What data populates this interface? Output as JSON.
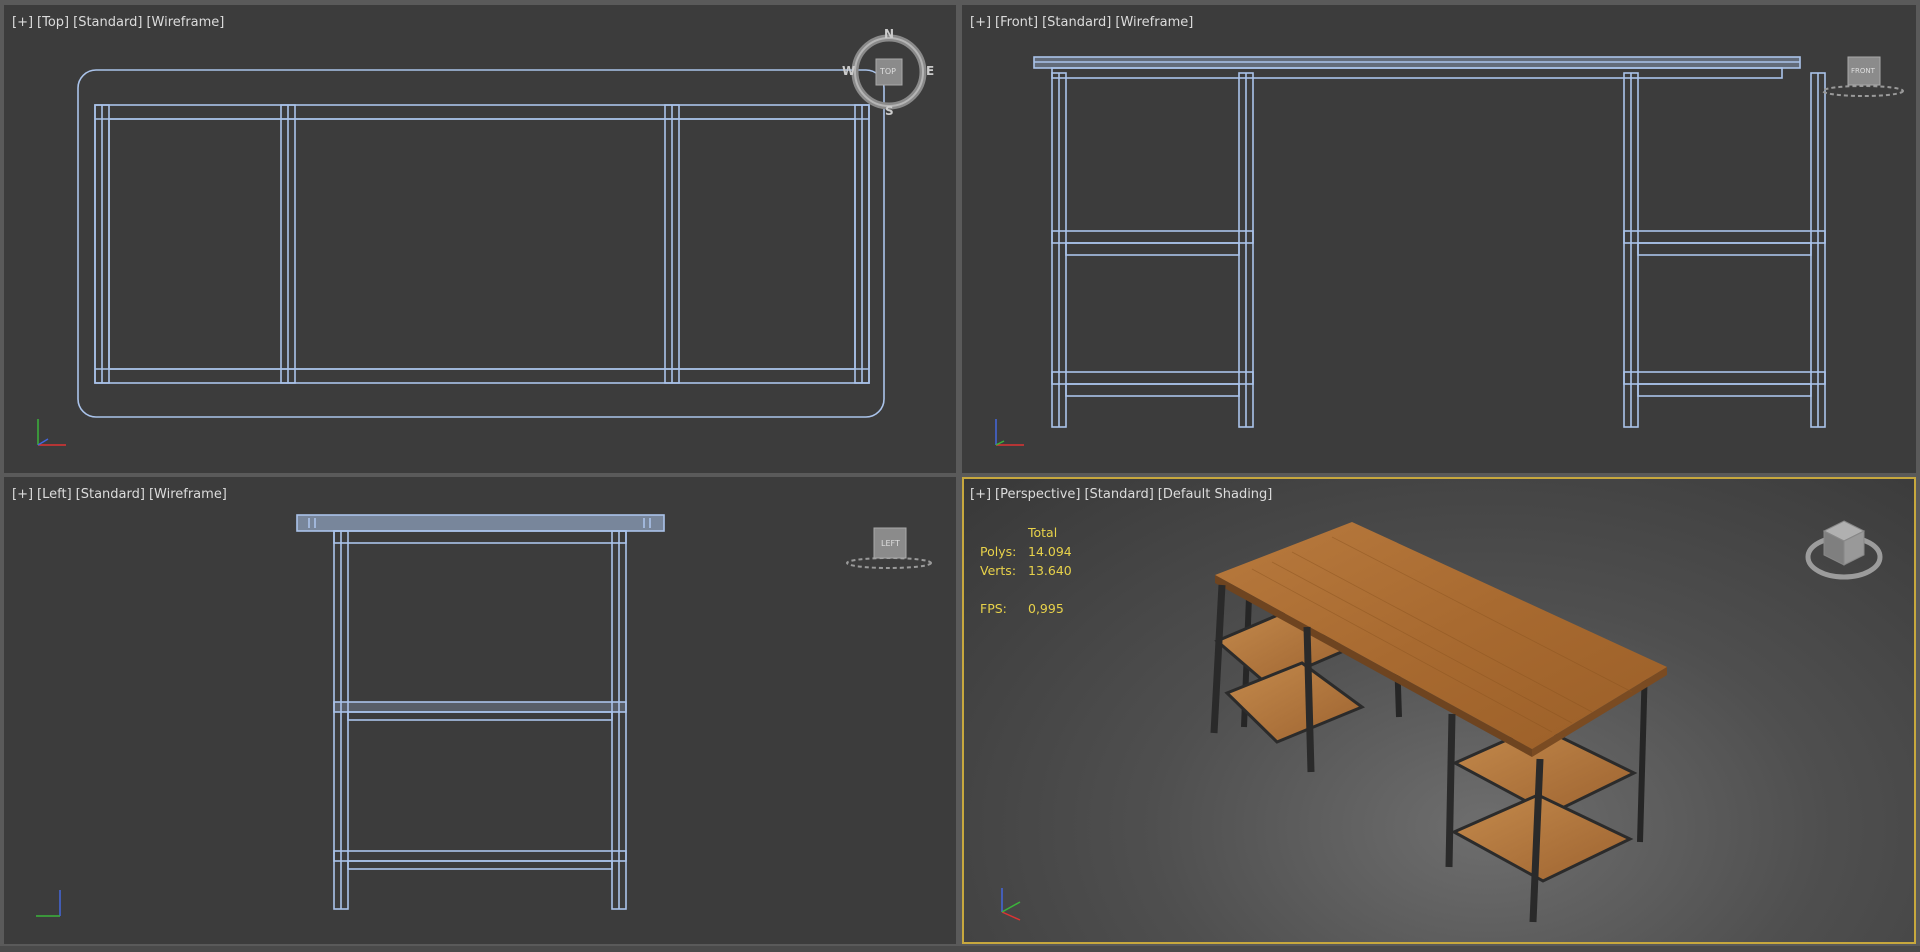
{
  "viewports": {
    "top": {
      "plus": "[+]",
      "view": "[Top]",
      "style": "[Standard]",
      "shading": "[Wireframe]",
      "cube_label": "TOP",
      "compass": {
        "n": "N",
        "s": "S",
        "e": "E",
        "w": "W"
      }
    },
    "front": {
      "plus": "[+]",
      "view": "[Front]",
      "style": "[Standard]",
      "shading": "[Wireframe]",
      "cube_label": "FRONT"
    },
    "left": {
      "plus": "[+]",
      "view": "[Left]",
      "style": "[Standard]",
      "shading": "[Wireframe]",
      "cube_label": "LEFT"
    },
    "persp": {
      "plus": "[+]",
      "view": "[Perspective]",
      "style": "[Standard]",
      "shading": "[Default Shading]"
    }
  },
  "stats": {
    "header": "Total",
    "polys_label": "Polys:",
    "polys": "14.094",
    "verts_label": "Verts:",
    "verts": "13.640",
    "fps_label": "FPS:",
    "fps": "0,995"
  },
  "colors": {
    "wire": "#aac3ea",
    "viewport_bg": "#3c3c3c",
    "active_border": "#c7a83e",
    "stats": "#e8d24a"
  }
}
